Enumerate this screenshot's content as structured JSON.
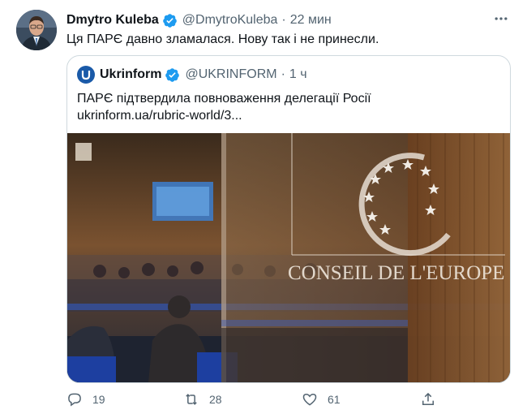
{
  "author": {
    "name": "Dmytro Kuleba",
    "handle": "@DmytroKuleba",
    "separator": "·",
    "time": "22 мин"
  },
  "tweet": {
    "text": "Ця ПАРЄ давно зламалася. Нову так і не принесли."
  },
  "quoted": {
    "name": "Ukrinform",
    "handle": "@UKRINFORM",
    "separator": "·",
    "time": "1 ч",
    "text_line1": "ПАРЄ підтвердила повноваження делегації Росії",
    "text_line2": "ukrinform.ua/rubric-world/3...",
    "image_sign": "CONSEIL DE L'EUROPE"
  },
  "actions": {
    "replies": "19",
    "retweets": "28",
    "likes": "61"
  },
  "colors": {
    "verified": "#1d9bf0",
    "secondary_text": "#536471",
    "border": "#cfd9de"
  },
  "icons": [
    "verified-badge-icon",
    "more-icon",
    "reply-icon",
    "retweet-icon",
    "like-icon",
    "share-icon"
  ]
}
